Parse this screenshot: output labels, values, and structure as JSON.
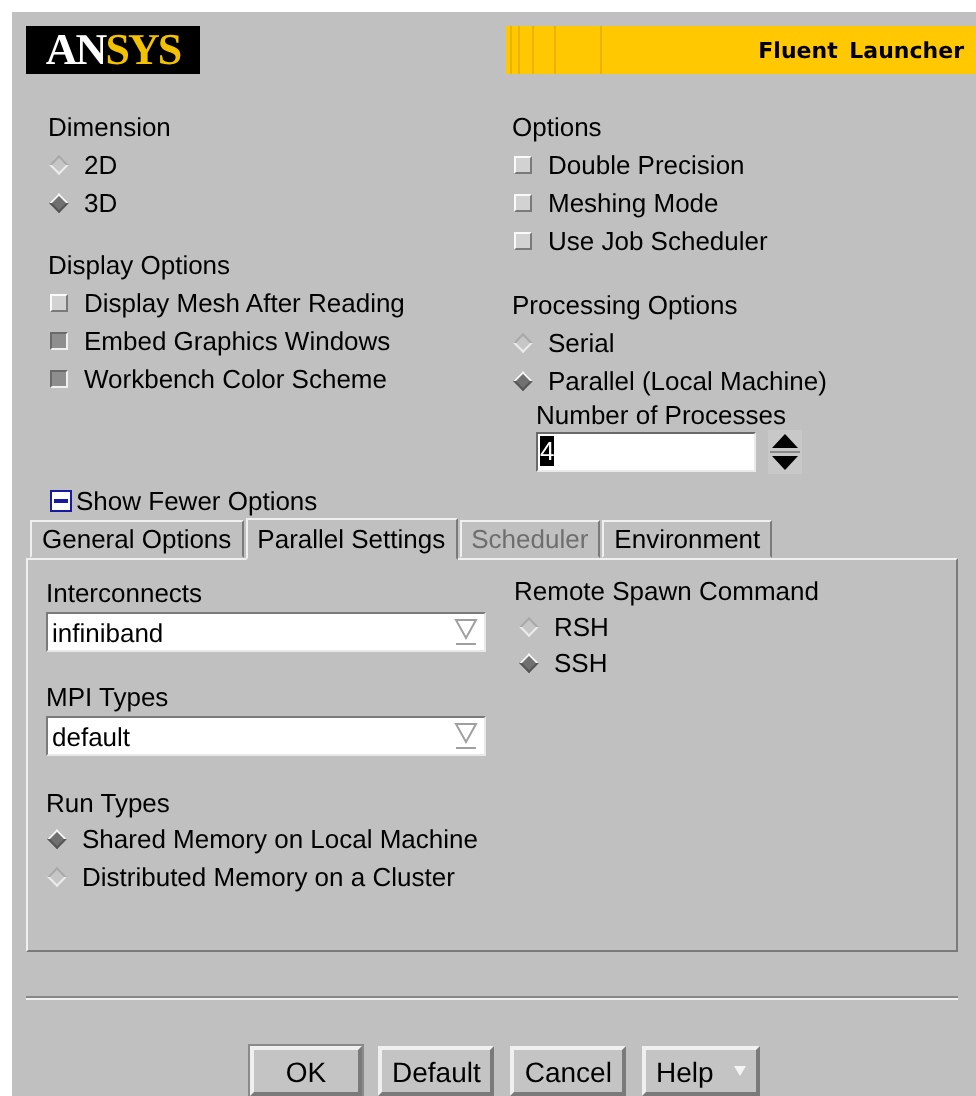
{
  "header": {
    "logo": "ANSYS",
    "title": "Fluent Launcher"
  },
  "dimension": {
    "label": "Dimension",
    "options": [
      {
        "label": "2D",
        "selected": false
      },
      {
        "label": "3D",
        "selected": true
      }
    ]
  },
  "display_options": {
    "label": "Display Options",
    "items": [
      {
        "label": "Display Mesh After Reading",
        "checked": false
      },
      {
        "label": "Embed Graphics Windows",
        "checked": true
      },
      {
        "label": "Workbench Color Scheme",
        "checked": true
      }
    ]
  },
  "options": {
    "label": "Options",
    "items": [
      {
        "label": "Double Precision",
        "checked": false
      },
      {
        "label": "Meshing Mode",
        "checked": false
      },
      {
        "label": "Use Job Scheduler",
        "checked": false
      }
    ]
  },
  "processing_options": {
    "label": "Processing Options",
    "options": [
      {
        "label": "Serial",
        "selected": false
      },
      {
        "label": "Parallel (Local Machine)",
        "selected": true
      }
    ],
    "processes": {
      "label": "Number of Processes",
      "value": "4"
    }
  },
  "toggle": {
    "label": "Show Fewer Options",
    "expanded": true
  },
  "tabs": [
    {
      "label": "General Options",
      "selected": false,
      "disabled": false
    },
    {
      "label": "Parallel Settings",
      "selected": true,
      "disabled": false
    },
    {
      "label": "Scheduler",
      "selected": false,
      "disabled": true
    },
    {
      "label": "Environment",
      "selected": false,
      "disabled": false
    }
  ],
  "parallel": {
    "interconnects": {
      "label": "Interconnects",
      "value": "infiniband"
    },
    "mpi_types": {
      "label": "MPI Types",
      "value": "default"
    },
    "run_types": {
      "label": "Run Types",
      "options": [
        {
          "label": "Shared Memory on Local Machine",
          "selected": true
        },
        {
          "label": "Distributed Memory on a Cluster",
          "selected": false
        }
      ]
    },
    "remote_spawn": {
      "label": "Remote Spawn Command",
      "options": [
        {
          "label": "RSH",
          "selected": false
        },
        {
          "label": "SSH",
          "selected": true
        }
      ]
    }
  },
  "buttons": [
    {
      "label": "OK",
      "kind": "default"
    },
    {
      "label": "Default",
      "kind": "plain"
    },
    {
      "label": "Cancel",
      "kind": "plain"
    },
    {
      "label": "Help",
      "kind": "menu"
    }
  ]
}
